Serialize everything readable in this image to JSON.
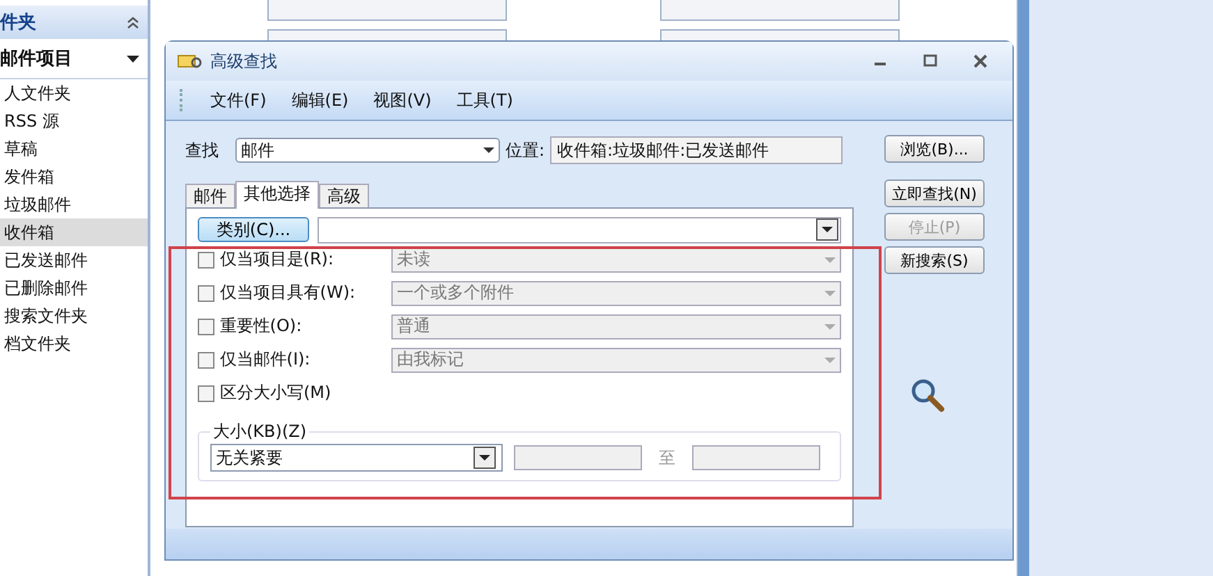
{
  "sidebar": {
    "header": "件夹",
    "section": "邮件项目",
    "items": [
      {
        "label": "人文件夹",
        "selected": false
      },
      {
        "label": "RSS 源",
        "selected": false
      },
      {
        "label": "草稿",
        "selected": false
      },
      {
        "label": "发件箱",
        "selected": false
      },
      {
        "label": "垃圾邮件",
        "selected": false
      },
      {
        "label": "收件箱",
        "selected": true
      },
      {
        "label": "已发送邮件",
        "selected": false
      },
      {
        "label": "已删除邮件",
        "selected": false
      },
      {
        "label": "搜索文件夹",
        "selected": false
      },
      {
        "label": "档文件夹",
        "selected": false
      }
    ]
  },
  "dialog": {
    "title": "高级查找",
    "menu": [
      "文件(F)",
      "编辑(E)",
      "视图(V)",
      "工具(T)"
    ],
    "find_label": "查找",
    "find_value": "邮件",
    "location_label": "位置:",
    "location_value": "收件箱:垃圾邮件:已发送邮件",
    "browse_button": "浏览(B)...",
    "tabs": [
      {
        "label": "邮件",
        "selected": false
      },
      {
        "label": "其他选择",
        "selected": true
      },
      {
        "label": "高级",
        "selected": false
      }
    ],
    "category_button": "类别(C)...",
    "criteria": [
      {
        "kind": "dropdown",
        "label": "仅当项目是(R):",
        "checked": false,
        "value": "未读"
      },
      {
        "kind": "dropdown",
        "label": "仅当项目具有(W):",
        "checked": false,
        "value": "一个或多个附件"
      },
      {
        "kind": "dropdown",
        "label": "重要性(O):",
        "checked": false,
        "value": "普通"
      },
      {
        "kind": "dropdown",
        "label": "仅当邮件(I):",
        "checked": false,
        "value": "由我标记"
      },
      {
        "kind": "checkbox",
        "label": "区分大小写(M)",
        "checked": false
      }
    ],
    "size": {
      "legend": "大小(KB)(Z)",
      "value": "无关紧要",
      "separator": "至"
    },
    "actions": [
      {
        "label": "立即查找(N)",
        "disabled": false
      },
      {
        "label": "停止(P)",
        "disabled": true
      },
      {
        "label": "新搜索(S)",
        "disabled": false
      }
    ]
  }
}
